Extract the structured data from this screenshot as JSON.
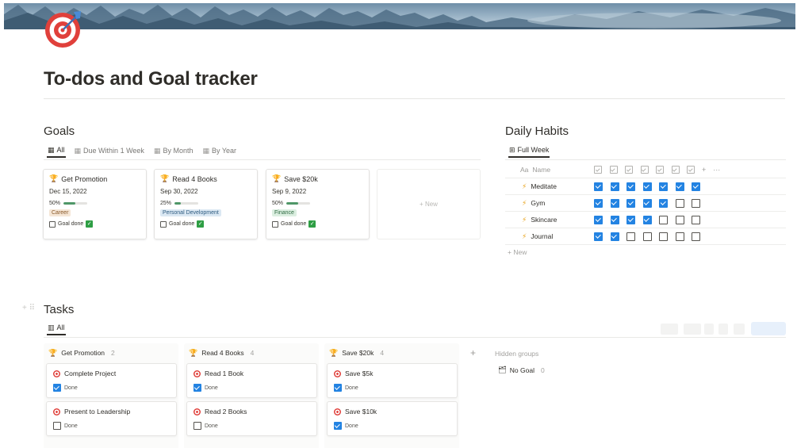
{
  "page": {
    "title": "To-dos and Goal tracker",
    "icon": "target-dart-icon"
  },
  "goals": {
    "heading": "Goals",
    "tabs": [
      {
        "label": "All",
        "icon": "gallery-icon",
        "active": true
      },
      {
        "label": "Due Within 1 Week",
        "icon": "gallery-icon",
        "active": false
      },
      {
        "label": "By Month",
        "icon": "gallery-icon",
        "active": false
      },
      {
        "label": "By Year",
        "icon": "gallery-icon",
        "active": false
      }
    ],
    "cards": [
      {
        "title": "Get Promotion",
        "date": "Dec 15, 2022",
        "progress_label": "50%",
        "progress": 0.5,
        "tag": "Career",
        "tag_bg": "#f5e6d6",
        "tag_color": "#8a5a2b",
        "goal_done": "Goal done"
      },
      {
        "title": "Read 4 Books",
        "date": "Sep 30, 2022",
        "progress_label": "25%",
        "progress": 0.25,
        "tag": "Personal Development",
        "tag_bg": "#dbe8f3",
        "tag_color": "#2f5c80",
        "goal_done": "Goal done"
      },
      {
        "title": "Save $20k",
        "date": "Sep 9, 2022",
        "progress_label": "50%",
        "progress": 0.5,
        "tag": "Finance",
        "tag_bg": "#dcefe1",
        "tag_color": "#2f6b42",
        "goal_done": "Goal done"
      }
    ],
    "new_label": "+ New"
  },
  "habits": {
    "heading": "Daily Habits",
    "tab": "Full Week",
    "name_col": "Name",
    "name_icon": "Aa",
    "rows": [
      {
        "name": "Meditate",
        "checks": [
          true,
          true,
          true,
          true,
          true,
          true,
          true
        ]
      },
      {
        "name": "Gym",
        "checks": [
          true,
          true,
          true,
          true,
          true,
          false,
          false
        ]
      },
      {
        "name": "Skincare",
        "checks": [
          true,
          true,
          true,
          true,
          false,
          false,
          false
        ]
      },
      {
        "name": "Journal",
        "checks": [
          true,
          true,
          false,
          false,
          false,
          false,
          false
        ]
      }
    ],
    "new_label": "+ New"
  },
  "tasks": {
    "heading": "Tasks",
    "tab": "All",
    "columns": [
      {
        "title": "Get Promotion",
        "count": "2",
        "items": [
          {
            "title": "Complete Project",
            "done_label": "Done",
            "done": true
          },
          {
            "title": "Present to Leadership",
            "done_label": "Done",
            "done": false
          }
        ]
      },
      {
        "title": "Read 4 Books",
        "count": "4",
        "items": [
          {
            "title": "Read 1 Book",
            "done_label": "Done",
            "done": true
          },
          {
            "title": "Read 2 Books",
            "done_label": "Done",
            "done": false
          }
        ]
      },
      {
        "title": "Save $20k",
        "count": "4",
        "items": [
          {
            "title": "Save $5k",
            "done_label": "Done",
            "done": true
          },
          {
            "title": "Save $10k",
            "done_label": "Done",
            "done": true
          }
        ]
      }
    ],
    "hidden_groups": "Hidden groups",
    "no_goal": {
      "label": "No Goal",
      "count": "0"
    }
  },
  "colors": {
    "accent_blue": "#2383e2",
    "progress_green": "#4f9768",
    "trophy": "#d9a53a",
    "bolt": "#e8a21a"
  }
}
